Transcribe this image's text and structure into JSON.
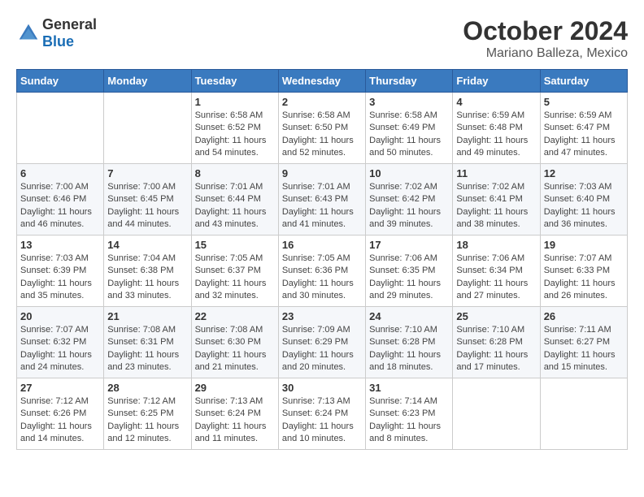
{
  "header": {
    "logo_general": "General",
    "logo_blue": "Blue",
    "month": "October 2024",
    "location": "Mariano Balleza, Mexico"
  },
  "weekdays": [
    "Sunday",
    "Monday",
    "Tuesday",
    "Wednesday",
    "Thursday",
    "Friday",
    "Saturday"
  ],
  "weeks": [
    [
      {
        "day": "",
        "sunrise": "",
        "sunset": "",
        "daylight": ""
      },
      {
        "day": "",
        "sunrise": "",
        "sunset": "",
        "daylight": ""
      },
      {
        "day": "1",
        "sunrise": "Sunrise: 6:58 AM",
        "sunset": "Sunset: 6:52 PM",
        "daylight": "Daylight: 11 hours and 54 minutes."
      },
      {
        "day": "2",
        "sunrise": "Sunrise: 6:58 AM",
        "sunset": "Sunset: 6:50 PM",
        "daylight": "Daylight: 11 hours and 52 minutes."
      },
      {
        "day": "3",
        "sunrise": "Sunrise: 6:58 AM",
        "sunset": "Sunset: 6:49 PM",
        "daylight": "Daylight: 11 hours and 50 minutes."
      },
      {
        "day": "4",
        "sunrise": "Sunrise: 6:59 AM",
        "sunset": "Sunset: 6:48 PM",
        "daylight": "Daylight: 11 hours and 49 minutes."
      },
      {
        "day": "5",
        "sunrise": "Sunrise: 6:59 AM",
        "sunset": "Sunset: 6:47 PM",
        "daylight": "Daylight: 11 hours and 47 minutes."
      }
    ],
    [
      {
        "day": "6",
        "sunrise": "Sunrise: 7:00 AM",
        "sunset": "Sunset: 6:46 PM",
        "daylight": "Daylight: 11 hours and 46 minutes."
      },
      {
        "day": "7",
        "sunrise": "Sunrise: 7:00 AM",
        "sunset": "Sunset: 6:45 PM",
        "daylight": "Daylight: 11 hours and 44 minutes."
      },
      {
        "day": "8",
        "sunrise": "Sunrise: 7:01 AM",
        "sunset": "Sunset: 6:44 PM",
        "daylight": "Daylight: 11 hours and 43 minutes."
      },
      {
        "day": "9",
        "sunrise": "Sunrise: 7:01 AM",
        "sunset": "Sunset: 6:43 PM",
        "daylight": "Daylight: 11 hours and 41 minutes."
      },
      {
        "day": "10",
        "sunrise": "Sunrise: 7:02 AM",
        "sunset": "Sunset: 6:42 PM",
        "daylight": "Daylight: 11 hours and 39 minutes."
      },
      {
        "day": "11",
        "sunrise": "Sunrise: 7:02 AM",
        "sunset": "Sunset: 6:41 PM",
        "daylight": "Daylight: 11 hours and 38 minutes."
      },
      {
        "day": "12",
        "sunrise": "Sunrise: 7:03 AM",
        "sunset": "Sunset: 6:40 PM",
        "daylight": "Daylight: 11 hours and 36 minutes."
      }
    ],
    [
      {
        "day": "13",
        "sunrise": "Sunrise: 7:03 AM",
        "sunset": "Sunset: 6:39 PM",
        "daylight": "Daylight: 11 hours and 35 minutes."
      },
      {
        "day": "14",
        "sunrise": "Sunrise: 7:04 AM",
        "sunset": "Sunset: 6:38 PM",
        "daylight": "Daylight: 11 hours and 33 minutes."
      },
      {
        "day": "15",
        "sunrise": "Sunrise: 7:05 AM",
        "sunset": "Sunset: 6:37 PM",
        "daylight": "Daylight: 11 hours and 32 minutes."
      },
      {
        "day": "16",
        "sunrise": "Sunrise: 7:05 AM",
        "sunset": "Sunset: 6:36 PM",
        "daylight": "Daylight: 11 hours and 30 minutes."
      },
      {
        "day": "17",
        "sunrise": "Sunrise: 7:06 AM",
        "sunset": "Sunset: 6:35 PM",
        "daylight": "Daylight: 11 hours and 29 minutes."
      },
      {
        "day": "18",
        "sunrise": "Sunrise: 7:06 AM",
        "sunset": "Sunset: 6:34 PM",
        "daylight": "Daylight: 11 hours and 27 minutes."
      },
      {
        "day": "19",
        "sunrise": "Sunrise: 7:07 AM",
        "sunset": "Sunset: 6:33 PM",
        "daylight": "Daylight: 11 hours and 26 minutes."
      }
    ],
    [
      {
        "day": "20",
        "sunrise": "Sunrise: 7:07 AM",
        "sunset": "Sunset: 6:32 PM",
        "daylight": "Daylight: 11 hours and 24 minutes."
      },
      {
        "day": "21",
        "sunrise": "Sunrise: 7:08 AM",
        "sunset": "Sunset: 6:31 PM",
        "daylight": "Daylight: 11 hours and 23 minutes."
      },
      {
        "day": "22",
        "sunrise": "Sunrise: 7:08 AM",
        "sunset": "Sunset: 6:30 PM",
        "daylight": "Daylight: 11 hours and 21 minutes."
      },
      {
        "day": "23",
        "sunrise": "Sunrise: 7:09 AM",
        "sunset": "Sunset: 6:29 PM",
        "daylight": "Daylight: 11 hours and 20 minutes."
      },
      {
        "day": "24",
        "sunrise": "Sunrise: 7:10 AM",
        "sunset": "Sunset: 6:28 PM",
        "daylight": "Daylight: 11 hours and 18 minutes."
      },
      {
        "day": "25",
        "sunrise": "Sunrise: 7:10 AM",
        "sunset": "Sunset: 6:28 PM",
        "daylight": "Daylight: 11 hours and 17 minutes."
      },
      {
        "day": "26",
        "sunrise": "Sunrise: 7:11 AM",
        "sunset": "Sunset: 6:27 PM",
        "daylight": "Daylight: 11 hours and 15 minutes."
      }
    ],
    [
      {
        "day": "27",
        "sunrise": "Sunrise: 7:12 AM",
        "sunset": "Sunset: 6:26 PM",
        "daylight": "Daylight: 11 hours and 14 minutes."
      },
      {
        "day": "28",
        "sunrise": "Sunrise: 7:12 AM",
        "sunset": "Sunset: 6:25 PM",
        "daylight": "Daylight: 11 hours and 12 minutes."
      },
      {
        "day": "29",
        "sunrise": "Sunrise: 7:13 AM",
        "sunset": "Sunset: 6:24 PM",
        "daylight": "Daylight: 11 hours and 11 minutes."
      },
      {
        "day": "30",
        "sunrise": "Sunrise: 7:13 AM",
        "sunset": "Sunset: 6:24 PM",
        "daylight": "Daylight: 11 hours and 10 minutes."
      },
      {
        "day": "31",
        "sunrise": "Sunrise: 7:14 AM",
        "sunset": "Sunset: 6:23 PM",
        "daylight": "Daylight: 11 hours and 8 minutes."
      },
      {
        "day": "",
        "sunrise": "",
        "sunset": "",
        "daylight": ""
      },
      {
        "day": "",
        "sunrise": "",
        "sunset": "",
        "daylight": ""
      }
    ]
  ]
}
